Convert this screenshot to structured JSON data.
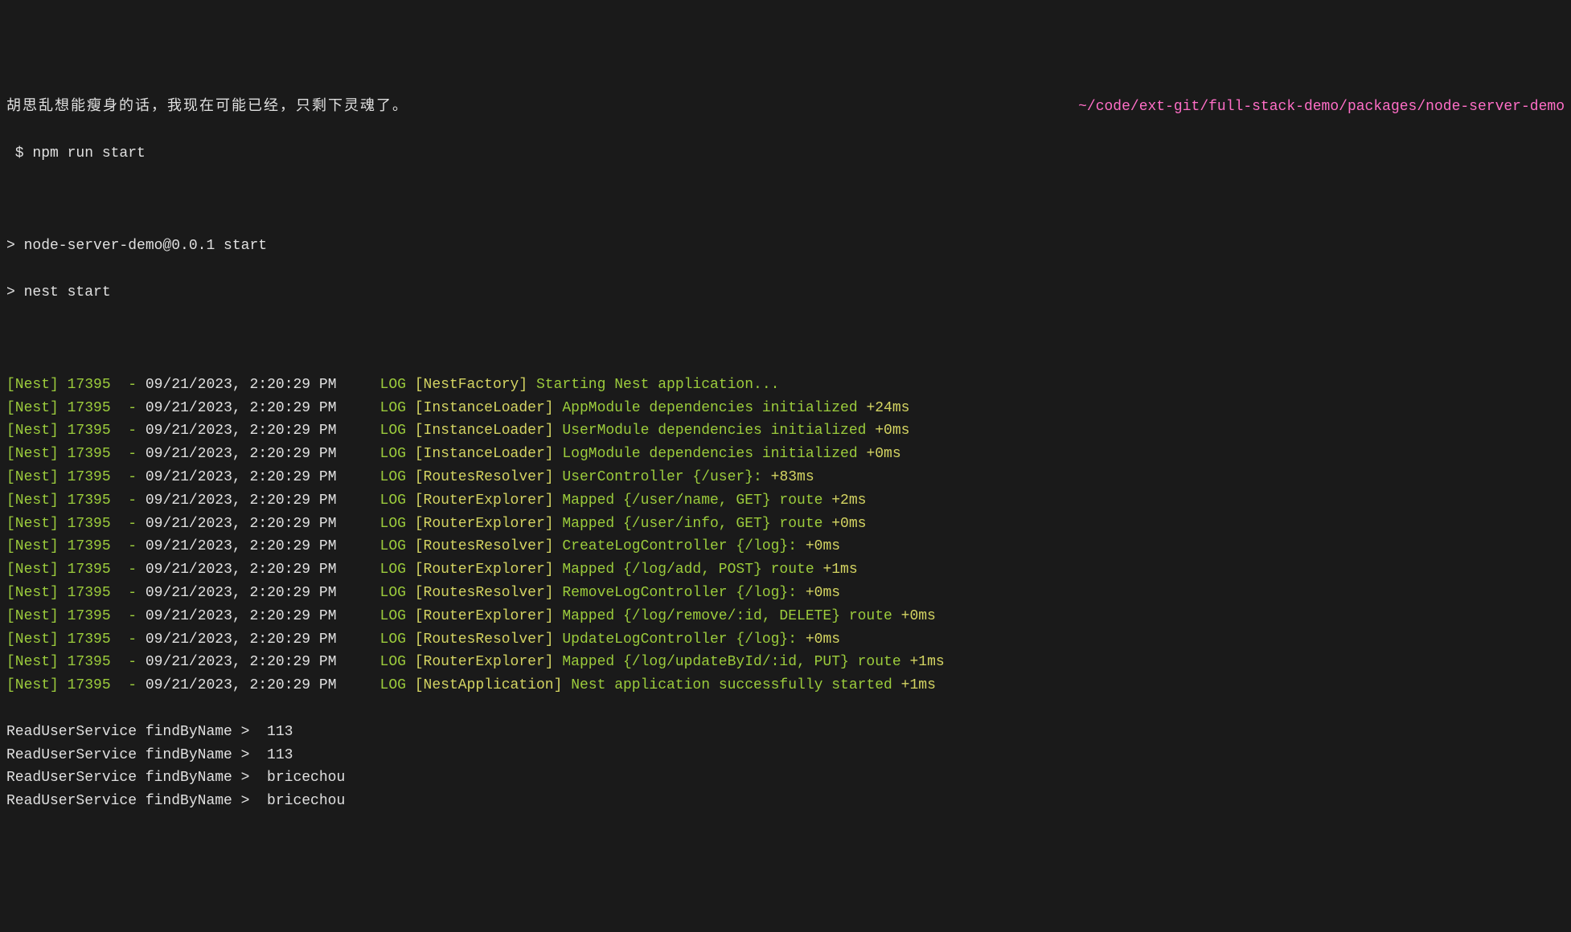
{
  "header": {
    "left_text": "胡思乱想能瘦身的话，我现在可能已经，只剩下灵魂了。",
    "right_path": "~/code/ext-git/full-stack-demo/packages/node-server-demo"
  },
  "prompt_line": {
    "prompt": " $ ",
    "command": "npm run start"
  },
  "script_output": {
    "line1": "> node-server-demo@0.0.1 start",
    "line2": "> nest start"
  },
  "nest_logs": [
    {
      "tag": "[Nest]",
      "pid": "17395",
      "dash": "  - ",
      "ts": "09/21/2023, 2:20:29 PM",
      "level": "LOG",
      "ctx": "[NestFactory]",
      "msg": "Starting Nest application...",
      "timing": ""
    },
    {
      "tag": "[Nest]",
      "pid": "17395",
      "dash": "  - ",
      "ts": "09/21/2023, 2:20:29 PM",
      "level": "LOG",
      "ctx": "[InstanceLoader]",
      "msg": "AppModule dependencies initialized",
      "timing": "+24ms"
    },
    {
      "tag": "[Nest]",
      "pid": "17395",
      "dash": "  - ",
      "ts": "09/21/2023, 2:20:29 PM",
      "level": "LOG",
      "ctx": "[InstanceLoader]",
      "msg": "UserModule dependencies initialized",
      "timing": "+0ms"
    },
    {
      "tag": "[Nest]",
      "pid": "17395",
      "dash": "  - ",
      "ts": "09/21/2023, 2:20:29 PM",
      "level": "LOG",
      "ctx": "[InstanceLoader]",
      "msg": "LogModule dependencies initialized",
      "timing": "+0ms"
    },
    {
      "tag": "[Nest]",
      "pid": "17395",
      "dash": "  - ",
      "ts": "09/21/2023, 2:20:29 PM",
      "level": "LOG",
      "ctx": "[RoutesResolver]",
      "msg": "UserController {/user}:",
      "timing": "+83ms"
    },
    {
      "tag": "[Nest]",
      "pid": "17395",
      "dash": "  - ",
      "ts": "09/21/2023, 2:20:29 PM",
      "level": "LOG",
      "ctx": "[RouterExplorer]",
      "msg": "Mapped {/user/name, GET} route",
      "timing": "+2ms"
    },
    {
      "tag": "[Nest]",
      "pid": "17395",
      "dash": "  - ",
      "ts": "09/21/2023, 2:20:29 PM",
      "level": "LOG",
      "ctx": "[RouterExplorer]",
      "msg": "Mapped {/user/info, GET} route",
      "timing": "+0ms"
    },
    {
      "tag": "[Nest]",
      "pid": "17395",
      "dash": "  - ",
      "ts": "09/21/2023, 2:20:29 PM",
      "level": "LOG",
      "ctx": "[RoutesResolver]",
      "msg": "CreateLogController {/log}:",
      "timing": "+0ms"
    },
    {
      "tag": "[Nest]",
      "pid": "17395",
      "dash": "  - ",
      "ts": "09/21/2023, 2:20:29 PM",
      "level": "LOG",
      "ctx": "[RouterExplorer]",
      "msg": "Mapped {/log/add, POST} route",
      "timing": "+1ms"
    },
    {
      "tag": "[Nest]",
      "pid": "17395",
      "dash": "  - ",
      "ts": "09/21/2023, 2:20:29 PM",
      "level": "LOG",
      "ctx": "[RoutesResolver]",
      "msg": "RemoveLogController {/log}:",
      "timing": "+0ms"
    },
    {
      "tag": "[Nest]",
      "pid": "17395",
      "dash": "  - ",
      "ts": "09/21/2023, 2:20:29 PM",
      "level": "LOG",
      "ctx": "[RouterExplorer]",
      "msg": "Mapped {/log/remove/:id, DELETE} route",
      "timing": "+0ms"
    },
    {
      "tag": "[Nest]",
      "pid": "17395",
      "dash": "  - ",
      "ts": "09/21/2023, 2:20:29 PM",
      "level": "LOG",
      "ctx": "[RoutesResolver]",
      "msg": "UpdateLogController {/log}:",
      "timing": "+0ms"
    },
    {
      "tag": "[Nest]",
      "pid": "17395",
      "dash": "  - ",
      "ts": "09/21/2023, 2:20:29 PM",
      "level": "LOG",
      "ctx": "[RouterExplorer]",
      "msg": "Mapped {/log/updateById/:id, PUT} route",
      "timing": "+1ms"
    },
    {
      "tag": "[Nest]",
      "pid": "17395",
      "dash": "  - ",
      "ts": "09/21/2023, 2:20:29 PM",
      "level": "LOG",
      "ctx": "[NestApplication]",
      "msg": "Nest application successfully started",
      "timing": "+1ms"
    }
  ],
  "service_logs": [
    "ReadUserService findByName >  113",
    "ReadUserService findByName >  113",
    "ReadUserService findByName >  bricechou",
    "ReadUserService findByName >  bricechou"
  ]
}
